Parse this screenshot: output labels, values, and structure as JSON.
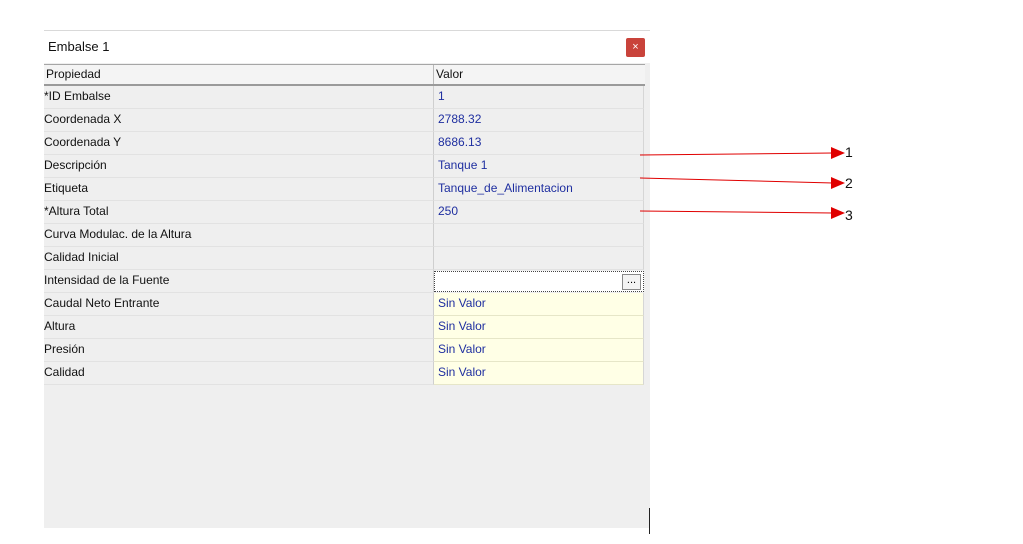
{
  "window": {
    "title": "Embalse 1",
    "close_label": "×"
  },
  "grid": {
    "headers": [
      "Propiedad",
      "Valor"
    ],
    "rows": [
      {
        "prop": "*ID Embalse",
        "value": "1",
        "kind": "normal"
      },
      {
        "prop": "Coordenada X",
        "value": "2788.32",
        "kind": "normal"
      },
      {
        "prop": "Coordenada Y",
        "value": "8686.13",
        "kind": "normal"
      },
      {
        "prop": "Descripción",
        "value": "Tanque 1",
        "kind": "normal"
      },
      {
        "prop": "Etiqueta",
        "value": "Tanque_de_Alimentacion",
        "kind": "normal"
      },
      {
        "prop": "*Altura Total",
        "value": "250",
        "kind": "normal"
      },
      {
        "prop": "Curva Modulac. de la Altura",
        "value": "",
        "kind": "normal"
      },
      {
        "prop": "Calidad Inicial",
        "value": "",
        "kind": "normal"
      },
      {
        "prop": "Intensidad de la Fuente",
        "value": "",
        "kind": "edit",
        "button": "..."
      },
      {
        "prop": "Caudal Neto Entrante",
        "value": "Sin Valor",
        "kind": "readonly"
      },
      {
        "prop": "Altura",
        "value": "Sin Valor",
        "kind": "readonly"
      },
      {
        "prop": "Presión",
        "value": "Sin Valor",
        "kind": "readonly"
      },
      {
        "prop": "Calidad",
        "value": "Sin Valor",
        "kind": "readonly"
      }
    ]
  },
  "annotations": {
    "labels": [
      "1",
      "2",
      "3"
    ],
    "color": "#e00000"
  }
}
